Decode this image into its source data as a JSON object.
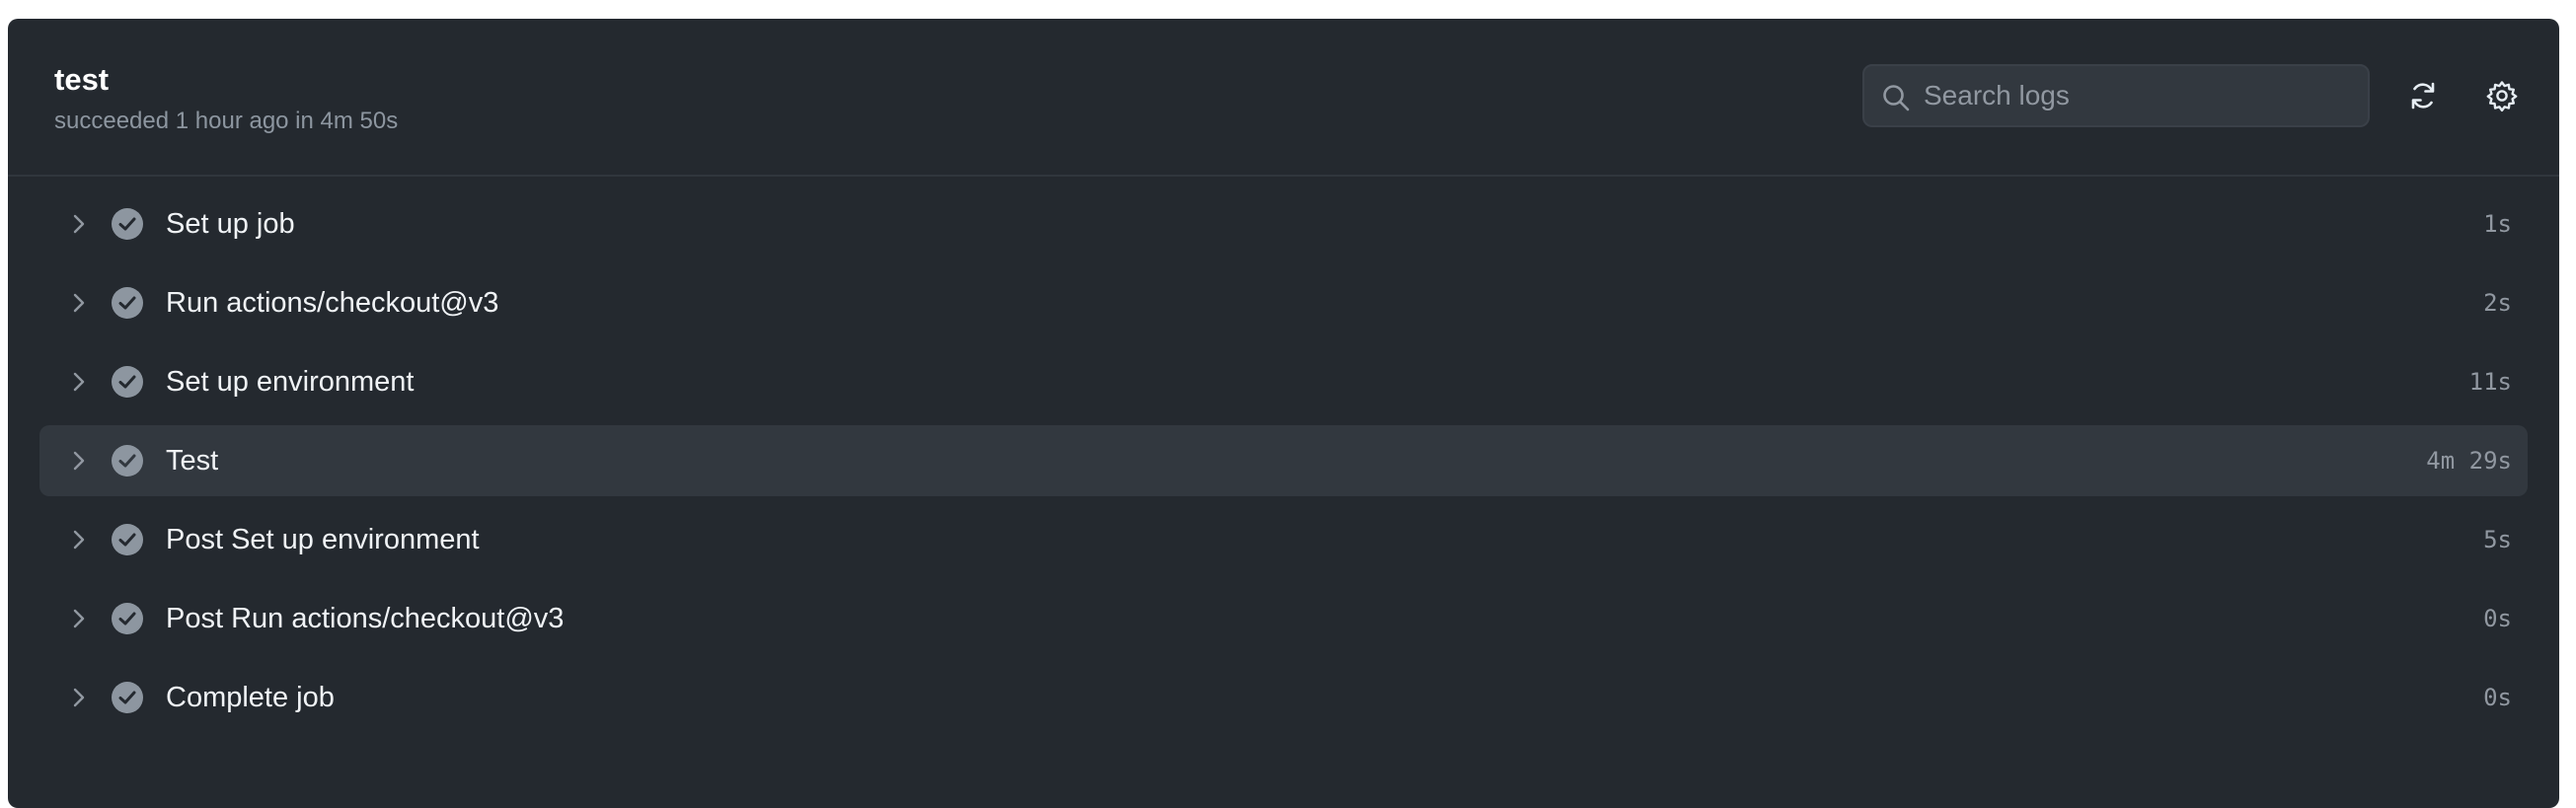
{
  "job": {
    "title": "test",
    "status": "succeeded 1 hour ago in 4m 50s"
  },
  "search": {
    "placeholder": "Search logs",
    "value": ""
  },
  "toolbar": {
    "refresh_icon": "sync-icon",
    "settings_icon": "gear-icon"
  },
  "colors": {
    "panel_background": "#24292f",
    "active_row": "#32383f",
    "check_icon": "#8d96a0"
  },
  "steps": [
    {
      "label": "Set up job",
      "duration": "1s",
      "status": "success",
      "expanded": false
    },
    {
      "label": "Run actions/checkout@v3",
      "duration": "2s",
      "status": "success",
      "expanded": false
    },
    {
      "label": "Set up environment",
      "duration": "11s",
      "status": "success",
      "expanded": false
    },
    {
      "label": "Test",
      "duration": "4m 29s",
      "status": "success",
      "expanded": false,
      "highlighted": true
    },
    {
      "label": "Post Set up environment",
      "duration": "5s",
      "status": "success",
      "expanded": false
    },
    {
      "label": "Post Run actions/checkout@v3",
      "duration": "0s",
      "status": "success",
      "expanded": false
    },
    {
      "label": "Complete job",
      "duration": "0s",
      "status": "success",
      "expanded": false
    }
  ]
}
